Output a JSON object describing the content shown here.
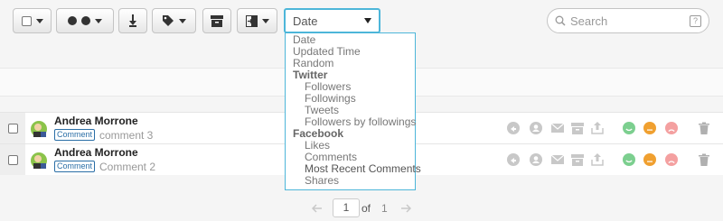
{
  "toolbar": {
    "sort_select": {
      "value": "Date"
    },
    "search": {
      "placeholder": "Search",
      "help_label": "?"
    }
  },
  "sort_options": [
    {
      "label": "Date",
      "kind": "option"
    },
    {
      "label": "Updated Time",
      "kind": "option"
    },
    {
      "label": "Random",
      "kind": "option"
    },
    {
      "label": "Twitter",
      "kind": "group"
    },
    {
      "label": "Followers",
      "kind": "sub"
    },
    {
      "label": "Followings",
      "kind": "sub"
    },
    {
      "label": "Tweets",
      "kind": "sub"
    },
    {
      "label": "Followers by followings",
      "kind": "sub"
    },
    {
      "label": "Facebook",
      "kind": "group"
    },
    {
      "label": "Likes",
      "kind": "sub"
    },
    {
      "label": "Comments",
      "kind": "sub"
    },
    {
      "label": "Most Recent Comments",
      "kind": "sub"
    },
    {
      "label": "Shares",
      "kind": "sub"
    }
  ],
  "rows": [
    {
      "name": "Andrea Morrone",
      "badge": "Comment",
      "text": "comment 3"
    },
    {
      "name": "Andrea Morrone",
      "badge": "Comment",
      "text": "Comment 2"
    }
  ],
  "pagination": {
    "current": "1",
    "of_label": "of",
    "total": "1"
  },
  "colors": {
    "accent": "#4db6d9",
    "positive": "#7ccf8f",
    "neutral": "#f0a030",
    "negative": "#f4a0a0"
  }
}
